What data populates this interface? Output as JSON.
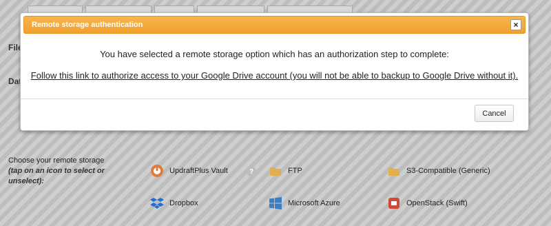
{
  "background": {
    "partial_labels": [
      "File",
      "Dat"
    ],
    "storage": {
      "label": "Choose your remote storage",
      "hint": "(tap on an icon to select or unselect):",
      "options": [
        {
          "label": "UpdraftPlus Vault",
          "icon": "updraftplus-vault-icon"
        },
        {
          "label": "FTP",
          "icon": "folder-icon"
        },
        {
          "label": "S3-Compatible (Generic)",
          "icon": "folder-icon"
        },
        {
          "label": "Dropbox",
          "icon": "dropbox-icon"
        },
        {
          "label": "Microsoft Azure",
          "icon": "windows-icon"
        },
        {
          "label": "OpenStack (Swift)",
          "icon": "openstack-icon"
        }
      ],
      "help": "?"
    }
  },
  "dialog": {
    "title": "Remote storage authentication",
    "close_symbol": "×",
    "message": "You have selected a remote storage option which has an authorization step to complete:",
    "link_text": "Follow this link to authorize access to your Google Drive account (you will not be able to backup to Google Drive without it).",
    "cancel_label": "Cancel"
  },
  "colors": {
    "titlebar": "#f0a030",
    "folder": "#e0b050",
    "dropbox": "#1f6fd0",
    "windows": "#3a7fc4",
    "openstack": "#d04a3a"
  }
}
